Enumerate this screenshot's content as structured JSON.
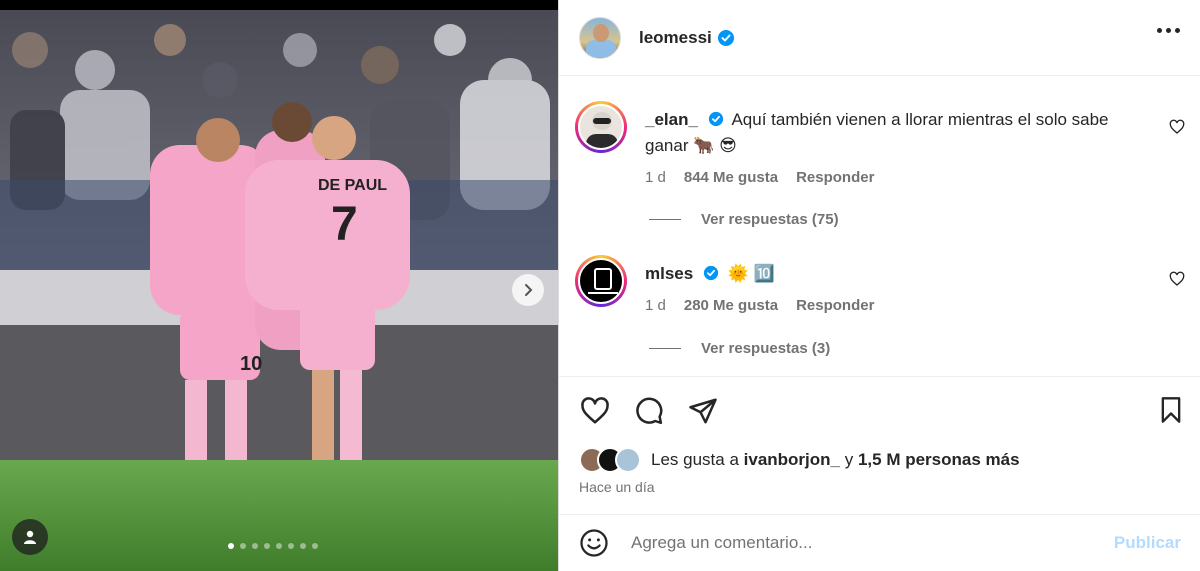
{
  "post": {
    "username": "leomessi",
    "carousel": {
      "total": 8,
      "current": 1
    }
  },
  "comments": [
    {
      "username": "_elan_",
      "text": "Aquí también vienen a llorar mientras el solo sabe ganar 🐂 😎",
      "age": "1 d",
      "likes": "844 Me gusta",
      "reply": "Responder",
      "view_replies": "Ver respuestas (75)"
    },
    {
      "username": "mlses",
      "text": "🌞 🔟",
      "age": "1 d",
      "likes": "280 Me gusta",
      "reply": "Responder",
      "view_replies": "Ver respuestas (3)"
    }
  ],
  "likes_line": {
    "prefix": "Les gusta a",
    "user": "ivanborjon_",
    "middle": "y",
    "count": "1,5 M personas más"
  },
  "timestamp": "Hace un día",
  "add_comment": {
    "placeholder": "Agrega un comentario...",
    "publish": "Publicar"
  },
  "colors": {
    "verified": "#0095f6",
    "publish_disabled": "#b3dbff",
    "jersey_pink": "#f5a6c8"
  }
}
